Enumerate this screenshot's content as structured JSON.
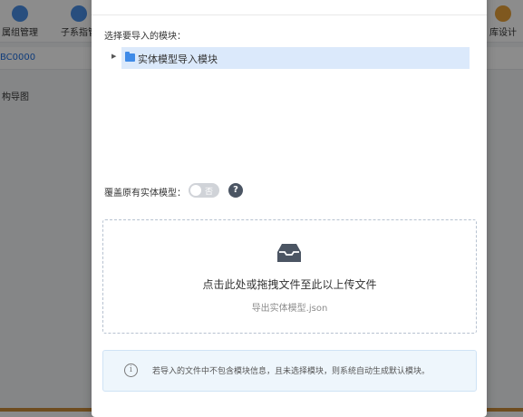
{
  "background": {
    "nav_items": [
      {
        "label": "属组管理",
        "color": "#4a8fe6"
      },
      {
        "label": "子系指管",
        "color": "#4a8fe6"
      },
      {
        "label": "库设计",
        "color": "#e8a13a"
      }
    ],
    "code": "BC0000",
    "sidebar_item": "构导图"
  },
  "modal": {
    "section_label": "选择要导入的模块：",
    "tree": [
      {
        "label": "实体模型导入模块",
        "icon": "folder-icon",
        "selected": true
      }
    ],
    "cover_label": "覆盖原有实体模型：",
    "switch_text": "否",
    "switch_on": false,
    "help_glyph": "?",
    "dropzone": {
      "title": "点击此处或拖拽文件至此以上传文件",
      "subtitle": "导出实体模型.json"
    },
    "alert": {
      "icon_glyph": "i",
      "text": "若导入的文件中不包含模块信息，且未选择模块，则系统自动生成默认模块。"
    }
  },
  "colors": {
    "accent": "#3f8be8",
    "selected_row": "#dbe9fb",
    "alert_bg": "#eef6fc"
  }
}
